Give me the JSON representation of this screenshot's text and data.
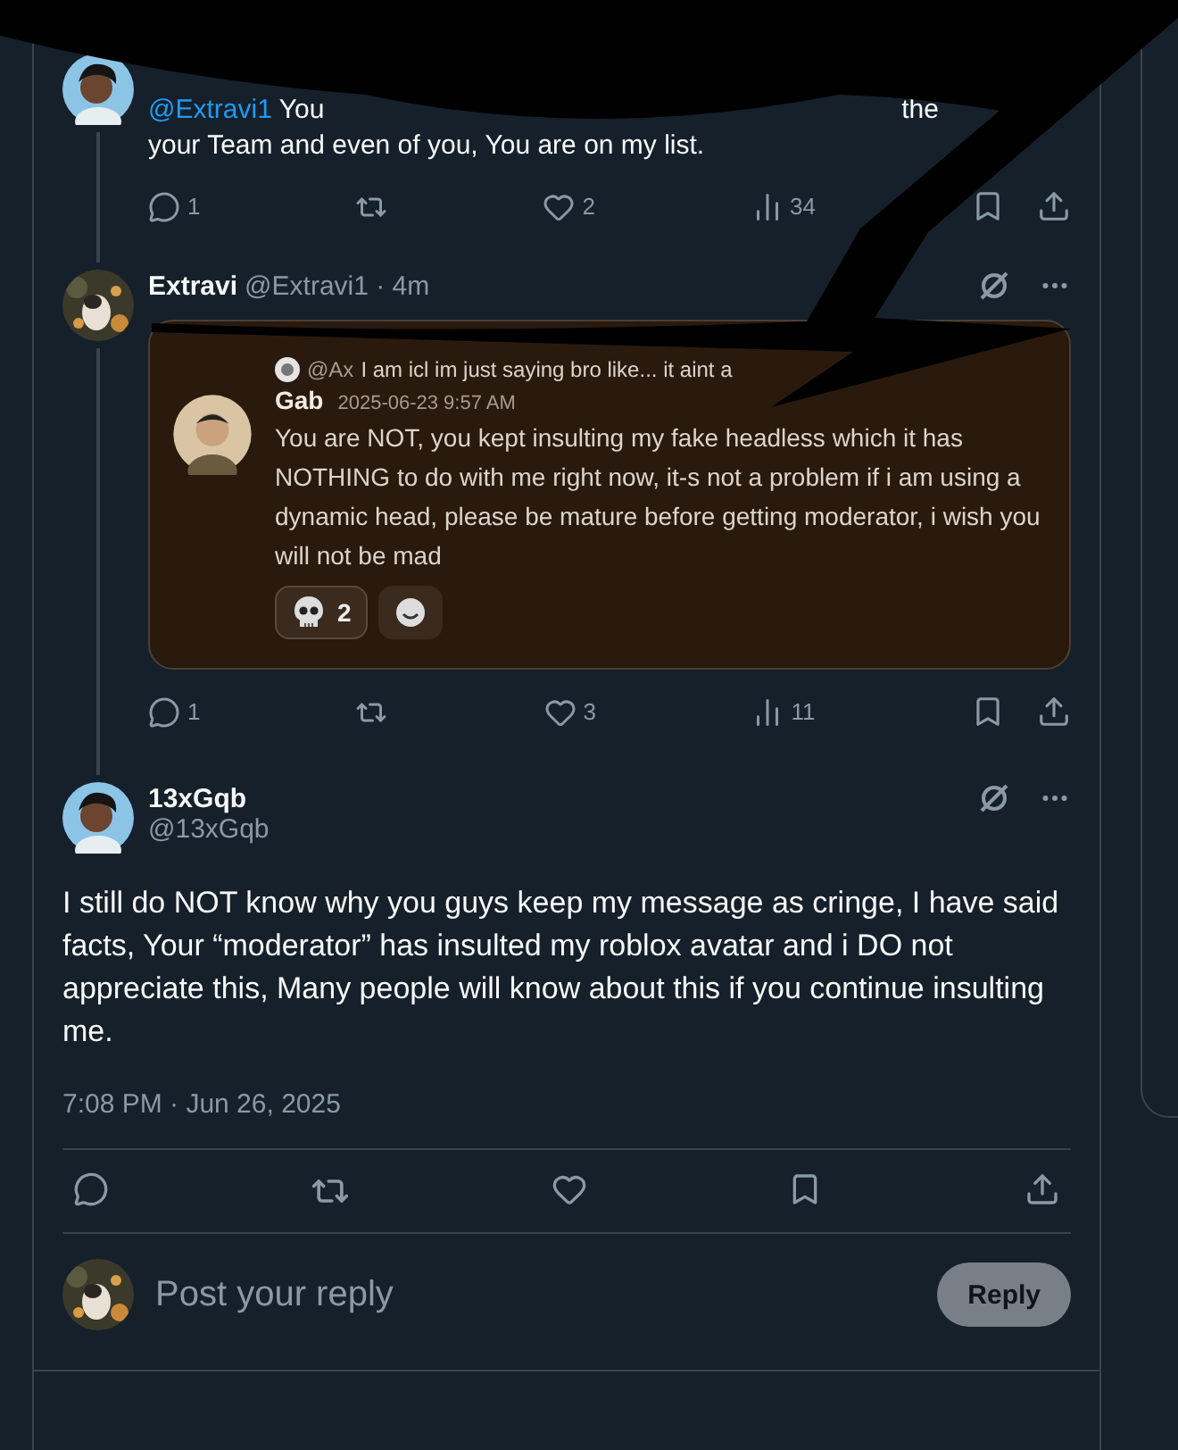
{
  "thread": [
    {
      "kind": "partial",
      "line1": [
        {
          "kind": "mention",
          "text": "@Extravi1"
        },
        {
          "kind": "text",
          "text": "You"
        },
        {
          "kind": "text",
          "text": "the"
        }
      ],
      "line2": "your Team and even of you, You are on my list.",
      "actions": {
        "replies": "1",
        "likes": "2",
        "views": "34"
      }
    },
    {
      "kind": "quote",
      "name": "Extravi",
      "meta": "@Extravi1 · 4m",
      "card": {
        "reply_ref": {
          "handle": "@Ax",
          "text": "I am icl im just saying bro like... it aint a"
        },
        "author": "Gab",
        "date": "2025-06-23 9:57 AM",
        "text": "You are NOT, you kept insulting my fake headless which it has NOTHING to do with me right now, it-s not a problem if i am using a dynamic head, please be mature before getting moderator, i wish you will not be mad",
        "reactions": [
          {
            "kind": "skull",
            "count": "2"
          },
          {
            "kind": "add"
          }
        ]
      },
      "actions": {
        "replies": "1",
        "likes": "3",
        "views": "11"
      }
    }
  ],
  "main_tweet": {
    "name": "13xGqb",
    "handle": "@13xGqb",
    "text": "I still do NOT know why you guys keep my message as cringe, I have said facts, Your “moderator” has insulted my roblox avatar and i DO not appreciate this, Many people will know about this if you continue insulting me.",
    "timestamp": "7:08 PM · Jun 26, 2025"
  },
  "reply_box": {
    "placeholder": "Post your reply",
    "button": "Reply"
  }
}
